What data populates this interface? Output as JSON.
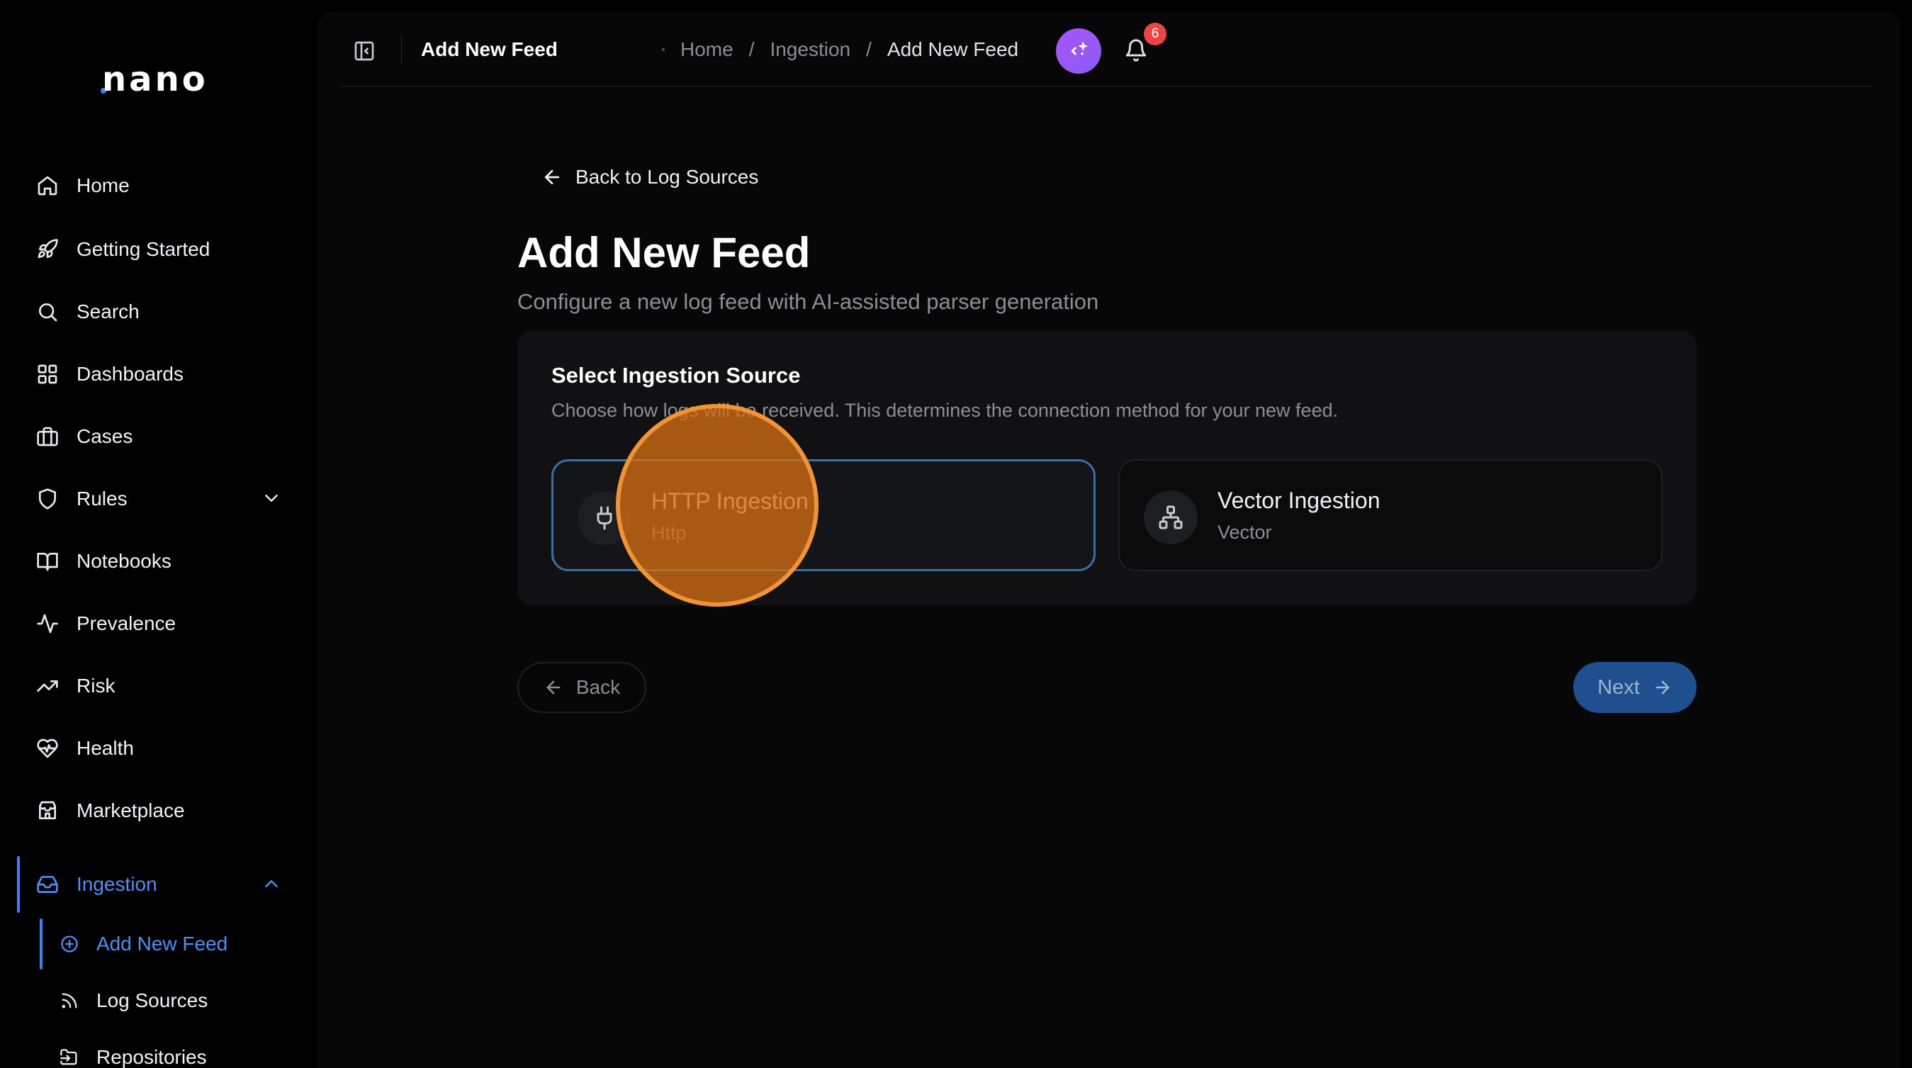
{
  "brand": {
    "logo_text": "nano",
    "accent": "#3b82f6"
  },
  "sidebar": {
    "items": [
      {
        "label": "Home",
        "icon": "home-icon"
      },
      {
        "label": "Getting Started",
        "icon": "rocket-icon"
      },
      {
        "label": "Search",
        "icon": "search-icon"
      },
      {
        "label": "Dashboards",
        "icon": "grid-icon"
      },
      {
        "label": "Cases",
        "icon": "briefcase-icon"
      },
      {
        "label": "Rules",
        "icon": "shield-icon",
        "expandable": true
      },
      {
        "label": "Notebooks",
        "icon": "book-icon"
      },
      {
        "label": "Prevalence",
        "icon": "activity-icon"
      },
      {
        "label": "Risk",
        "icon": "trending-up-icon"
      },
      {
        "label": "Health",
        "icon": "heart-pulse-icon"
      },
      {
        "label": "Marketplace",
        "icon": "store-icon"
      },
      {
        "label": "Ingestion",
        "icon": "inbox-icon",
        "expanded": true,
        "active": true
      }
    ],
    "ingestion_children": [
      {
        "label": "Add New Feed",
        "icon": "plus-circle-icon",
        "active": true
      },
      {
        "label": "Log Sources",
        "icon": "rss-icon"
      },
      {
        "label": "Repositories",
        "icon": "folder-input-icon"
      }
    ]
  },
  "topbar": {
    "title": "Add New Feed",
    "breadcrumbs": [
      "Home",
      "Ingestion",
      "Add New Feed"
    ],
    "breadcrumb_separator": "/",
    "notification_count": "6",
    "assistant_icon": "sparkle-code-icon",
    "bell_icon": "bell-icon"
  },
  "page": {
    "back_link": "Back to Log Sources",
    "title": "Add New Feed",
    "subtitle": "Configure a new log feed with AI-assisted parser generation"
  },
  "source_card": {
    "title": "Select Ingestion Source",
    "description": "Choose how logs will be received. This determines the connection method for your new feed.",
    "options": [
      {
        "name": "HTTP Ingestion",
        "type": "Http",
        "icon": "plug-icon",
        "selected": true
      },
      {
        "name": "Vector Ingestion",
        "type": "Vector",
        "icon": "network-icon",
        "selected": false
      }
    ]
  },
  "footer": {
    "back_label": "Back",
    "next_label": "Next"
  },
  "colors": {
    "selected_border": "#3a6ea8",
    "next_button": "#1f4f8f",
    "badge": "#ef4444",
    "click_indicator": "#f29433"
  }
}
